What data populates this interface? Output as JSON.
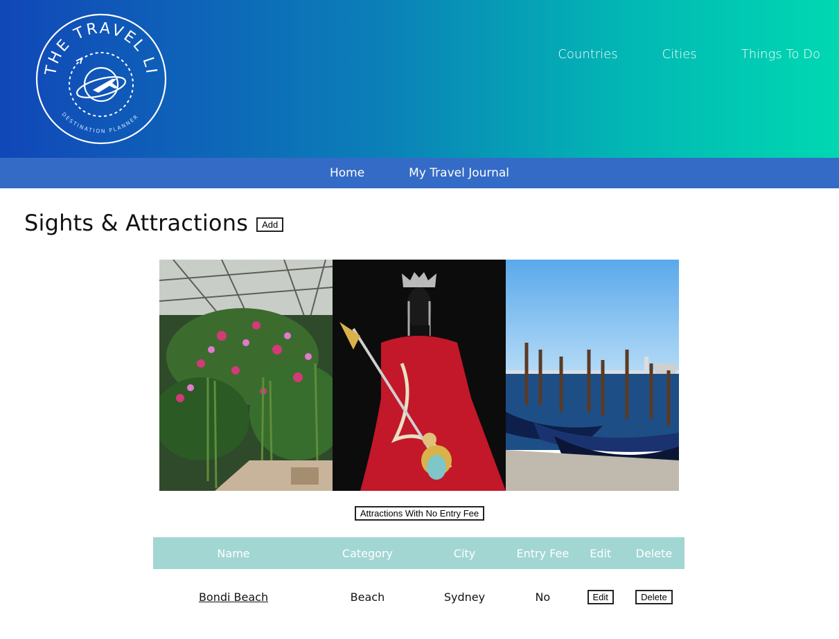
{
  "header": {
    "logo": {
      "title_text": "THE TRAVEL LIST",
      "tagline": "DESTINATION PLANNER"
    },
    "nav": [
      "Countries",
      "Cities",
      "Things To Do"
    ]
  },
  "subnav": [
    "Home",
    "My Travel Journal"
  ],
  "main": {
    "title": "Sights & Attractions",
    "add_label": "Add",
    "filter_label": "Attractions With No Entry Fee"
  },
  "table": {
    "headers": [
      "Name",
      "Category",
      "City",
      "Entry Fee",
      "Edit",
      "Delete"
    ],
    "rows": [
      {
        "name": "Bondi Beach",
        "category": "Beach",
        "city": "Sydney",
        "entry_fee": "No",
        "edit_label": "Edit",
        "delete_label": "Delete"
      }
    ]
  },
  "colors": {
    "header_gradient_start": "#1147b8",
    "header_gradient_end": "#00d8b2",
    "subnav_bg": "#346bc6",
    "table_header_bg": "#a2d6d3"
  }
}
